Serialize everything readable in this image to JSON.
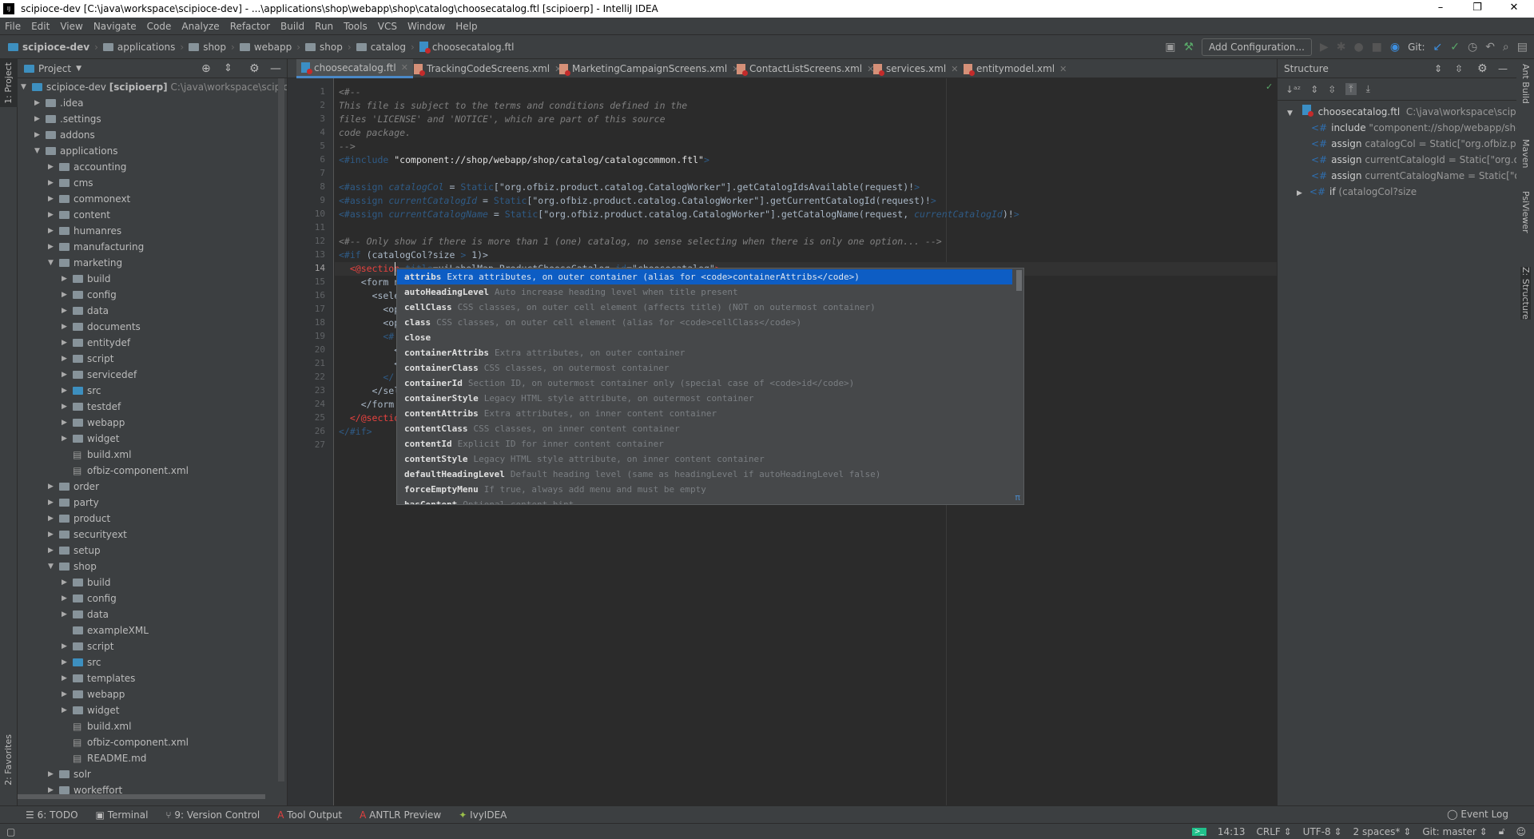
{
  "window": {
    "title": "scipioce-dev [C:\\java\\workspace\\scipioce-dev] - ...\\applications\\shop\\webapp\\shop\\catalog\\choosecatalog.ftl [scipioerp] - IntelliJ IDEA",
    "minimize": "–",
    "maximize": "❐",
    "close": "✕"
  },
  "menu": [
    "File",
    "Edit",
    "View",
    "Navigate",
    "Code",
    "Analyze",
    "Refactor",
    "Build",
    "Run",
    "Tools",
    "VCS",
    "Window",
    "Help"
  ],
  "breadcrumb": [
    "scipioce-dev",
    "applications",
    "shop",
    "webapp",
    "shop",
    "catalog",
    "choosecatalog.ftl"
  ],
  "toolbar": {
    "add_configuration": "Add Configuration...",
    "git_label": "Git:"
  },
  "left_strip": {
    "project": "1: Project",
    "favorites": "2: Favorites"
  },
  "project": {
    "title": "Project",
    "root": {
      "name": "scipioce-dev",
      "module": "[scipioerp]",
      "path": "C:\\java\\workspace\\scipioce-dev"
    },
    "items": [
      {
        "l": 1,
        "n": ".idea",
        "t": "dir",
        "o": false
      },
      {
        "l": 1,
        "n": ".settings",
        "t": "dir",
        "o": false
      },
      {
        "l": 1,
        "n": "addons",
        "t": "dir",
        "o": false
      },
      {
        "l": 1,
        "n": "applications",
        "t": "dir",
        "o": true
      },
      {
        "l": 2,
        "n": "accounting",
        "t": "dir",
        "o": false
      },
      {
        "l": 2,
        "n": "cms",
        "t": "dir",
        "o": false
      },
      {
        "l": 2,
        "n": "commonext",
        "t": "dir",
        "o": false
      },
      {
        "l": 2,
        "n": "content",
        "t": "dir",
        "o": false
      },
      {
        "l": 2,
        "n": "humanres",
        "t": "dir",
        "o": false
      },
      {
        "l": 2,
        "n": "manufacturing",
        "t": "dir",
        "o": false
      },
      {
        "l": 2,
        "n": "marketing",
        "t": "dir",
        "o": true
      },
      {
        "l": 3,
        "n": "build",
        "t": "dir",
        "o": false
      },
      {
        "l": 3,
        "n": "config",
        "t": "dir",
        "o": false
      },
      {
        "l": 3,
        "n": "data",
        "t": "dir",
        "o": false
      },
      {
        "l": 3,
        "n": "documents",
        "t": "dir",
        "o": false
      },
      {
        "l": 3,
        "n": "entitydef",
        "t": "dir",
        "o": false
      },
      {
        "l": 3,
        "n": "script",
        "t": "dir",
        "o": false
      },
      {
        "l": 3,
        "n": "servicedef",
        "t": "dir",
        "o": false
      },
      {
        "l": 3,
        "n": "src",
        "t": "src",
        "o": false
      },
      {
        "l": 3,
        "n": "testdef",
        "t": "dir",
        "o": false
      },
      {
        "l": 3,
        "n": "webapp",
        "t": "dir",
        "o": false
      },
      {
        "l": 3,
        "n": "widget",
        "t": "dir",
        "o": false
      },
      {
        "l": 3,
        "n": "build.xml",
        "t": "file"
      },
      {
        "l": 3,
        "n": "ofbiz-component.xml",
        "t": "file"
      },
      {
        "l": 2,
        "n": "order",
        "t": "dir",
        "o": false
      },
      {
        "l": 2,
        "n": "party",
        "t": "dir",
        "o": false
      },
      {
        "l": 2,
        "n": "product",
        "t": "dir",
        "o": false
      },
      {
        "l": 2,
        "n": "securityext",
        "t": "dir",
        "o": false
      },
      {
        "l": 2,
        "n": "setup",
        "t": "dir",
        "o": false
      },
      {
        "l": 2,
        "n": "shop",
        "t": "dir",
        "o": true
      },
      {
        "l": 3,
        "n": "build",
        "t": "dir",
        "o": false
      },
      {
        "l": 3,
        "n": "config",
        "t": "dir",
        "o": false
      },
      {
        "l": 3,
        "n": "data",
        "t": "dir",
        "o": false
      },
      {
        "l": 3,
        "n": "exampleXML",
        "t": "leafdir"
      },
      {
        "l": 3,
        "n": "script",
        "t": "dir",
        "o": false
      },
      {
        "l": 3,
        "n": "src",
        "t": "src",
        "o": false
      },
      {
        "l": 3,
        "n": "templates",
        "t": "dir",
        "o": false
      },
      {
        "l": 3,
        "n": "webapp",
        "t": "dir",
        "o": false
      },
      {
        "l": 3,
        "n": "widget",
        "t": "dir",
        "o": false
      },
      {
        "l": 3,
        "n": "build.xml",
        "t": "file"
      },
      {
        "l": 3,
        "n": "ofbiz-component.xml",
        "t": "file"
      },
      {
        "l": 3,
        "n": "README.md",
        "t": "file"
      },
      {
        "l": 2,
        "n": "solr",
        "t": "dir",
        "o": false
      },
      {
        "l": 2,
        "n": "workeffort",
        "t": "dir",
        "o": false
      }
    ]
  },
  "tabs": [
    {
      "label": "choosecatalog.ftl",
      "type": "ftl",
      "active": true
    },
    {
      "label": "TrackingCodeScreens.xml",
      "type": "xml"
    },
    {
      "label": "MarketingCampaignScreens.xml",
      "type": "xml"
    },
    {
      "label": "ContactListScreens.xml",
      "type": "xml"
    },
    {
      "label": "services.xml",
      "type": "xml"
    },
    {
      "label": "entitymodel.xml",
      "type": "xml"
    }
  ],
  "editor": {
    "current_line": 14,
    "lines": [
      [
        [
          "cm",
          "<#--"
        ]
      ],
      [
        [
          "cm",
          "This file is subject to the terms and conditions defined in the"
        ]
      ],
      [
        [
          "cm",
          "files 'LICENSE' and 'NOTICE', which are part of this source"
        ]
      ],
      [
        [
          "cm",
          "code package."
        ]
      ],
      [
        [
          "cm",
          "-->"
        ]
      ],
      [
        [
          "dir",
          "<#include "
        ],
        [
          "str",
          "\"component://shop/webapp/shop/catalog/catalogcommon.ftl\""
        ],
        [
          "dir",
          ">"
        ]
      ],
      [],
      [
        [
          "dir",
          "<#assign "
        ],
        [
          "var",
          "catalogCol"
        ],
        [
          "txt",
          " = "
        ],
        [
          "dir",
          "Static"
        ],
        [
          "txt",
          "[\"org.ofbiz.product.catalog.CatalogWorker\"].getCatalogIdsAvailable(request)!"
        ],
        [
          "dir",
          ">"
        ]
      ],
      [
        [
          "dir",
          "<#assign "
        ],
        [
          "var",
          "currentCatalogId"
        ],
        [
          "txt",
          " = "
        ],
        [
          "dir",
          "Static"
        ],
        [
          "txt",
          "[\"org.ofbiz.product.catalog.CatalogWorker\"].getCurrentCatalogId(request)!"
        ],
        [
          "dir",
          ">"
        ]
      ],
      [
        [
          "dir",
          "<#assign "
        ],
        [
          "var",
          "currentCatalogName"
        ],
        [
          "txt",
          " = "
        ],
        [
          "dir",
          "Static"
        ],
        [
          "txt",
          "[\"org.ofbiz.product.catalog.CatalogWorker\"].getCatalogName(request, "
        ],
        [
          "var",
          "currentCatalogId"
        ],
        [
          "txt",
          ")!"
        ],
        [
          "dir",
          ">"
        ]
      ],
      [],
      [
        [
          "cm",
          "<#-- Only show if there is more than 1 (one) catalog, no sense selecting when there is only one option... -->"
        ]
      ],
      [
        [
          "dir",
          "<#if "
        ],
        [
          "txt",
          "(catalogCol?size "
        ],
        [
          "dir",
          ">"
        ],
        [
          "txt",
          " 1)>"
        ]
      ],
      [
        [
          "red",
          "  <@section "
        ],
        [
          "dir",
          "title"
        ],
        [
          "txt",
          "=uiLabelMap.ProductChooseCatalog "
        ],
        [
          "dir",
          "id"
        ],
        [
          "txt",
          "=\"choosecatalog\""
        ],
        [
          "red",
          ">"
        ]
      ],
      [
        [
          "txt",
          "    <form n"
        ]
      ],
      [
        [
          "txt",
          "      <sele"
        ]
      ],
      [
        [
          "txt",
          "        <op"
        ]
      ],
      [
        [
          "txt",
          "        <op"
        ]
      ],
      [
        [
          "dir",
          "        <#"
        ]
      ],
      [
        [
          "txt",
          "          <"
        ]
      ],
      [
        [
          "txt",
          "          <"
        ]
      ],
      [
        [
          "dir",
          "        </"
        ]
      ],
      [
        [
          "txt",
          "      </sel"
        ]
      ],
      [
        [
          "txt",
          "    </form"
        ]
      ],
      [
        [
          "red",
          "  </@sectio"
        ]
      ],
      [
        [
          "dir",
          "</#if>"
        ]
      ],
      []
    ]
  },
  "completion": {
    "selected": 0,
    "items": [
      {
        "name": "attribs",
        "desc": "Extra attributes, on outer container (alias for <code>containerAttribs</code>)"
      },
      {
        "name": "autoHeadingLevel",
        "desc": "Auto increase heading level when title present"
      },
      {
        "name": "cellClass",
        "desc": "CSS classes, on outer cell element (affects title) (NOT on outermost container)"
      },
      {
        "name": "class",
        "desc": "CSS classes, on outer cell element (alias for <code>cellClass</code>)"
      },
      {
        "name": "close",
        "desc": ""
      },
      {
        "name": "containerAttribs",
        "desc": "Extra attributes, on outer container"
      },
      {
        "name": "containerClass",
        "desc": "CSS classes, on outermost container"
      },
      {
        "name": "containerId",
        "desc": "Section ID, on outermost container only (special case of <code>id</code>)"
      },
      {
        "name": "containerStyle",
        "desc": "Legacy HTML style attribute, on outermost container"
      },
      {
        "name": "contentAttribs",
        "desc": "Extra attributes, on inner content container"
      },
      {
        "name": "contentClass",
        "desc": "CSS classes, on inner content container"
      },
      {
        "name": "contentId",
        "desc": "Explicit ID for inner content container"
      },
      {
        "name": "contentStyle",
        "desc": "Legacy HTML style attribute, on inner content container"
      },
      {
        "name": "defaultHeadingLevel",
        "desc": "Default heading level (same as headingLevel if autoHeadingLevel false)"
      },
      {
        "name": "forceEmptyMenu",
        "desc": "If true, always add menu and must be empty"
      },
      {
        "name": "hasContent",
        "desc": "Optional content hint"
      }
    ],
    "pi": "π"
  },
  "structure": {
    "title": "Structure",
    "root": {
      "name": "choosecatalog.ftl",
      "path": "C:\\java\\workspace\\scipioce-dev"
    },
    "items": [
      {
        "k": "include",
        "v": "\"component://shop/webapp/shop/catalog/catalogcommon.ftl\""
      },
      {
        "k": "assign",
        "v": "catalogCol = Static[\"org.ofbiz.product.catalog.CatalogWorker\"]"
      },
      {
        "k": "assign",
        "v": "currentCatalogId = Static[\"org.ofbiz.product.catalog.CatalogWorker\"]"
      },
      {
        "k": "assign",
        "v": "currentCatalogName = Static[\"org.ofbiz.product.catalog.CatalogWorker\"]"
      },
      {
        "k": "if",
        "v": "(catalogCol?size",
        "collapsed": true
      }
    ]
  },
  "right_strip": {
    "ant": "Ant Build",
    "maven": "Maven",
    "psiviewer": "PsiViewer",
    "structure": "Z: Structure"
  },
  "bottom_tools": [
    "6: TODO",
    "Terminal",
    "9: Version Control",
    "Tool Output",
    "ANTLR Preview",
    "IvyIDEA"
  ],
  "event_log": "Event Log",
  "status": {
    "position": "14:13",
    "line_sep": "CRLF ⇕",
    "encoding": "UTF-8 ⇕",
    "indent": "2 spaces* ⇕",
    "vcs": "Git: master ⇕"
  },
  "colors": {
    "selection": "#0d5dc4",
    "editor_bg": "#2b2b2b",
    "panel_bg": "#3c3f41",
    "tab_underline": "#4a88c7",
    "error_red": "#e8423f"
  }
}
